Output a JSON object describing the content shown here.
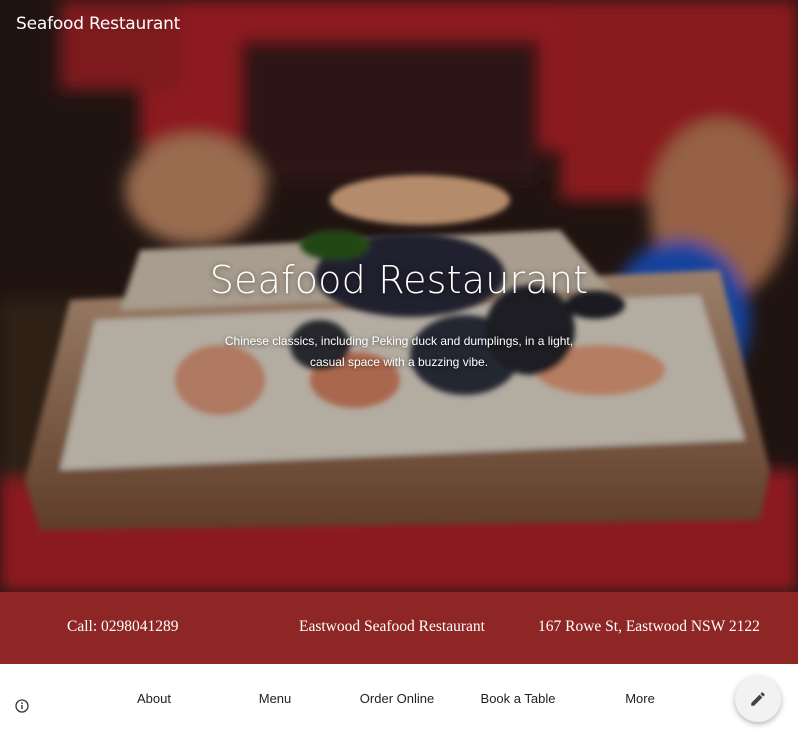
{
  "header": {
    "site_title": "Seafood Restaurant"
  },
  "hero": {
    "title": "Seafood Restaurant",
    "description": "Chinese classics, including Peking duck and dumplings, in a light, casual space with a buzzing vibe."
  },
  "info_bar": {
    "phone": "Call: 0298041289",
    "name": "Eastwood Seafood Restaurant",
    "address": "167 Rowe St, Eastwood NSW 2122"
  },
  "nav": {
    "items": [
      {
        "label": "About"
      },
      {
        "label": "Menu"
      },
      {
        "label": "Order Online"
      },
      {
        "label": "Book a Table"
      },
      {
        "label": "More"
      }
    ]
  },
  "icons": {
    "info": "info-icon",
    "edit": "pencil-icon"
  },
  "colors": {
    "info_bar_bg": "#8e2626",
    "hero_shirt": "#c0262c",
    "glove": "#1f56c9"
  }
}
